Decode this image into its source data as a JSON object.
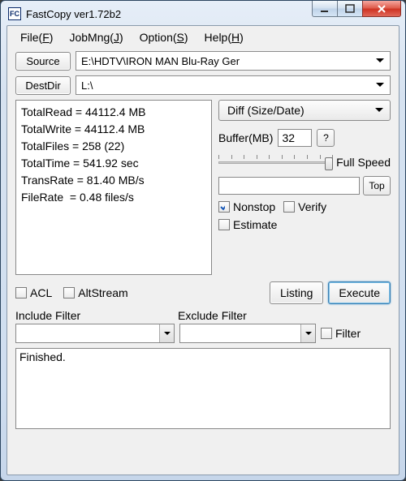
{
  "window": {
    "title": "FastCopy ver1.72b2",
    "icon_text": "FC"
  },
  "menu": {
    "file": "File(",
    "file_u": "F",
    "file_after": ")",
    "jobmng": "JobMng(",
    "jobmng_u": "J",
    "jobmng_after": ")",
    "option": "Option(",
    "option_u": "S",
    "option_after": ")",
    "help": "Help(",
    "help_u": "H",
    "help_after": ")"
  },
  "buttons": {
    "source": "Source",
    "destdir": "DestDir",
    "question": "?",
    "top": "Top",
    "listing": "Listing",
    "execute": "Execute"
  },
  "paths": {
    "source": "E:\\HDTV\\IRON MAN Blu-Ray Ger",
    "dest": "L:\\"
  },
  "mode": {
    "selected": "Diff (Size/Date)"
  },
  "buffer": {
    "label": "Buffer(MB)",
    "value": "32"
  },
  "speed": {
    "label": "Full Speed"
  },
  "checks": {
    "nonstop": "Nonstop",
    "verify": "Verify",
    "estimate": "Estimate",
    "acl": "ACL",
    "altstream": "AltStream",
    "filter": "Filter"
  },
  "stats": {
    "l1": "TotalRead = 44112.4 MB",
    "l2": "TotalWrite = 44112.4 MB",
    "l3": "TotalFiles = 258 (22)",
    "l4": "TotalTime = 541.92 sec",
    "l5": "TransRate = 81.40 MB/s",
    "l6": "FileRate  = 0.48 files/s"
  },
  "filters": {
    "include_label": "Include Filter",
    "exclude_label": "Exclude Filter"
  },
  "log": {
    "text": "Finished."
  }
}
